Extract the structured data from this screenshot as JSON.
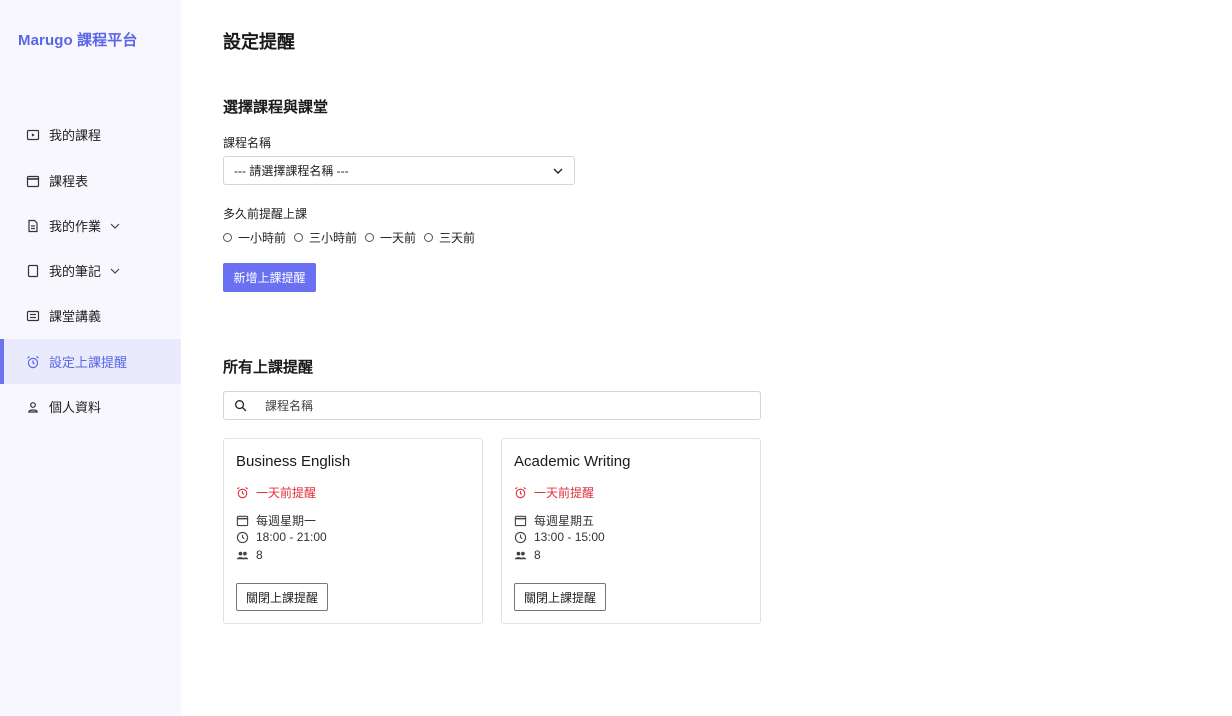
{
  "brand": "Marugo 課程平台",
  "sidebar": {
    "items": [
      {
        "label": "我的課程"
      },
      {
        "label": "課程表"
      },
      {
        "label": "我的作業"
      },
      {
        "label": "我的筆記"
      },
      {
        "label": "課堂講義"
      },
      {
        "label": "設定上課提醒"
      },
      {
        "label": "個人資料"
      }
    ],
    "active_index": 5
  },
  "page_title": "設定提醒",
  "create_section": {
    "title": "選擇課程與課堂",
    "course_label": "課程名稱",
    "course_select_value": "--- 請選擇課程名稱 ---",
    "remind_label": "多久前提醒上課",
    "radio_options": [
      "一小時前",
      "三小時前",
      "一天前",
      "三天前"
    ],
    "add_button": "新增上課提醒"
  },
  "list_section": {
    "title": "所有上課提醒",
    "search_placeholder": "課程名稱",
    "cards": [
      {
        "title": "Business English",
        "reminder": "一天前提醒",
        "schedule": "每週星期一",
        "time": "18:00 - 21:00",
        "count": "8",
        "button": "關閉上課提醒"
      },
      {
        "title": "Academic Writing",
        "reminder": "一天前提醒",
        "schedule": "每週星期五",
        "time": "13:00 - 15:00",
        "count": "8",
        "button": "關閉上課提醒"
      }
    ]
  },
  "colors": {
    "accent": "#5a66e6",
    "button": "#6a70f2",
    "alert": "#e0313c",
    "sidebar_bg": "#f7f7fd",
    "active_bg": "#e9eafb"
  }
}
